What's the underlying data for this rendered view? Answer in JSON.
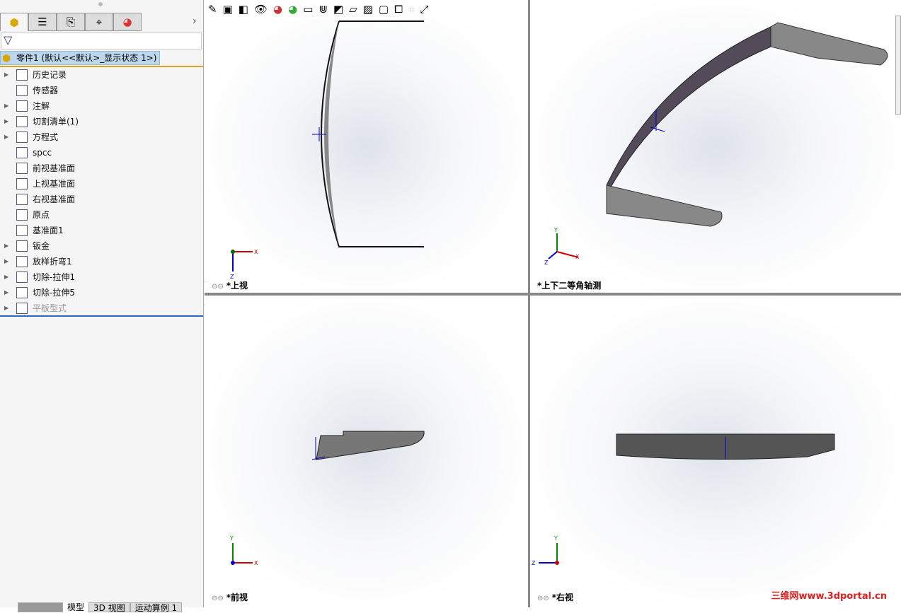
{
  "panel": {
    "tabs": [
      "feature-manager",
      "property-manager",
      "configuration-manager",
      "dimxpert-manager",
      "display-manager"
    ],
    "root": "零件1  (默认<<默认>_显示状态 1>)",
    "items": [
      {
        "label": "历史记录",
        "expand": true,
        "icon": "history-icon"
      },
      {
        "label": "传感器",
        "expand": false,
        "icon": "sensor-icon"
      },
      {
        "label": "注解",
        "expand": true,
        "icon": "annotation-icon"
      },
      {
        "label": "切割清单(1)",
        "expand": true,
        "icon": "cutlist-icon"
      },
      {
        "label": "方程式",
        "expand": true,
        "icon": "equation-icon"
      },
      {
        "label": "spcc",
        "expand": false,
        "icon": "material-icon"
      },
      {
        "label": "前视基准面",
        "expand": false,
        "icon": "plane-icon"
      },
      {
        "label": "上视基准面",
        "expand": false,
        "icon": "plane-icon"
      },
      {
        "label": "右视基准面",
        "expand": false,
        "icon": "plane-icon"
      },
      {
        "label": "原点",
        "expand": false,
        "icon": "origin-icon"
      },
      {
        "label": "基准面1",
        "expand": false,
        "icon": "plane-icon"
      },
      {
        "label": "钣金",
        "expand": true,
        "icon": "sheetmetal-icon"
      },
      {
        "label": "放样折弯1",
        "expand": true,
        "icon": "lofted-bend-icon"
      },
      {
        "label": "切除-拉伸1",
        "expand": true,
        "icon": "cut-extrude-icon"
      },
      {
        "label": "切除-拉伸5",
        "expand": true,
        "icon": "cut-extrude-icon"
      },
      {
        "label": "平板型式",
        "expand": true,
        "icon": "flat-pattern-icon",
        "dim": true
      }
    ]
  },
  "bottom_tabs": [
    "模型",
    "3D 视图",
    "运动算例 1"
  ],
  "viewports": {
    "top": "*上视",
    "iso": "*上下二等角轴测",
    "front": "*前视",
    "right": "*右视"
  },
  "watermark": "三维网www.3dportal.cn"
}
